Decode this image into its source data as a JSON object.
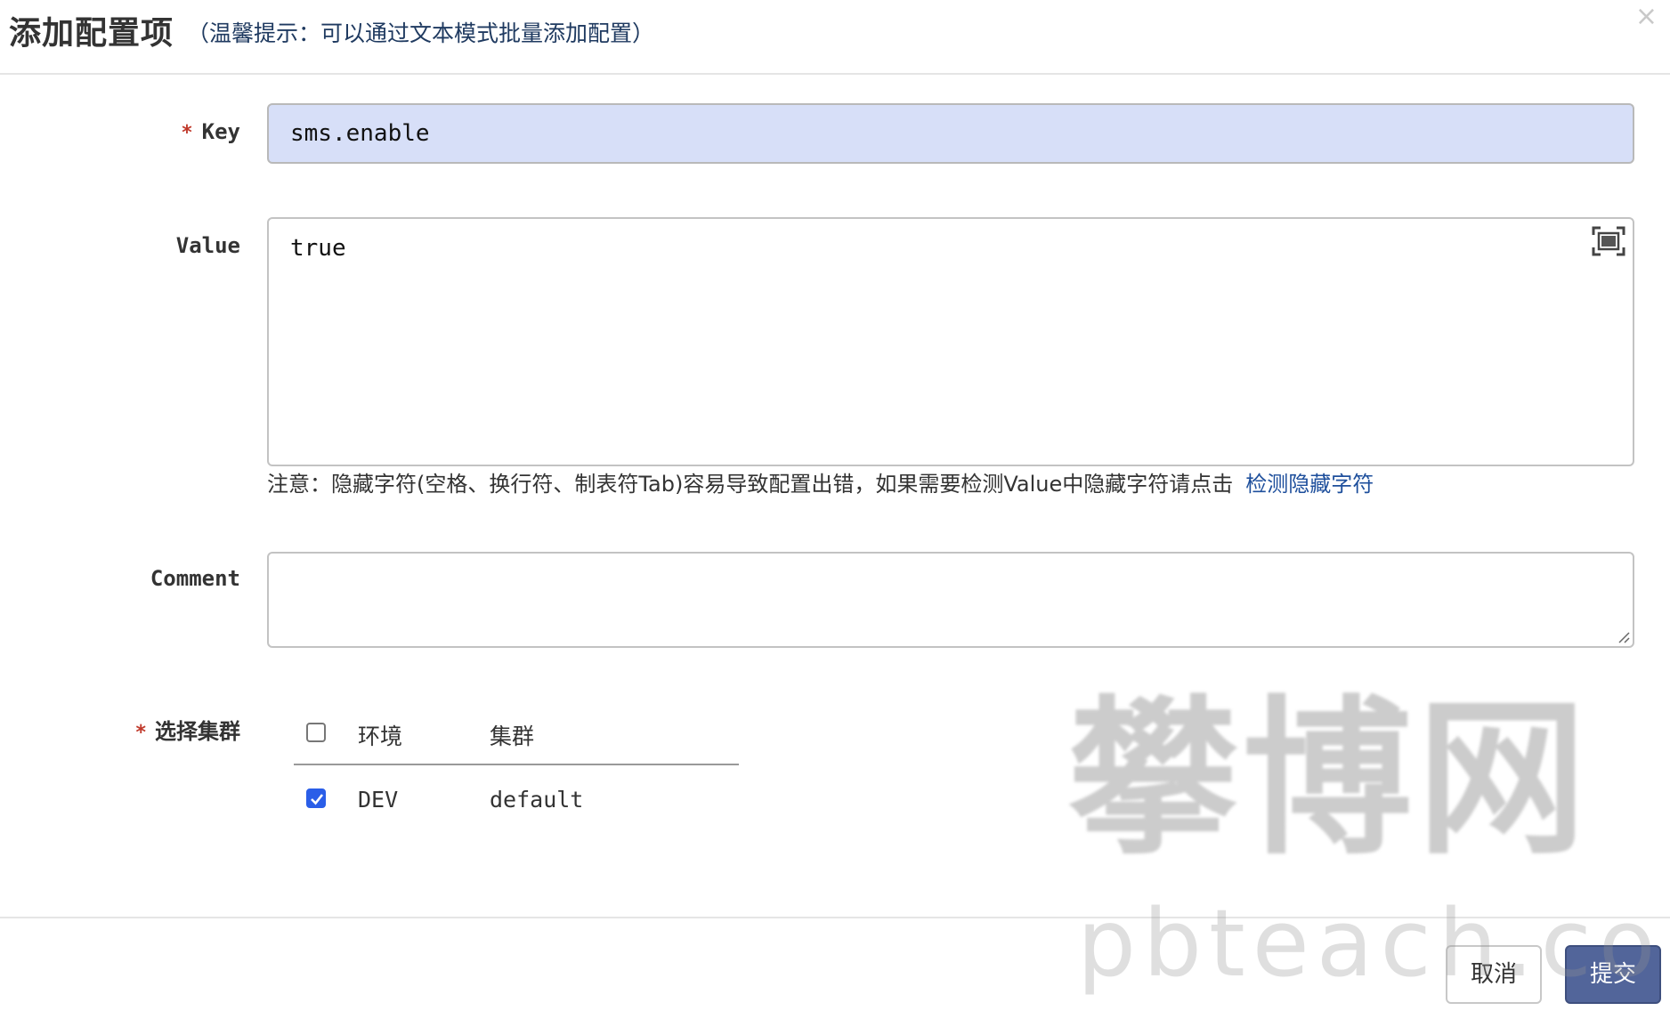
{
  "dialog": {
    "title": "添加配置项",
    "subtitle": "（温馨提示：可以通过文本模式批量添加配置）",
    "close_glyph": "×"
  },
  "form": {
    "key": {
      "required_mark": "*",
      "label": "Key",
      "value": "sms.enable"
    },
    "value": {
      "label": "Value",
      "text": "true",
      "fullscreen_icon": "fullscreen-icon",
      "note": "注意：隐藏字符(空格、换行符、制表符Tab)容易导致配置出错，如果需要检测Value中隐藏字符请点击",
      "note_link": "检测隐藏字符"
    },
    "comment": {
      "label": "Comment",
      "value": ""
    },
    "cluster": {
      "required_mark": "*",
      "label": "选择集群",
      "header_env": "环境",
      "header_cluster": "集群",
      "rows": [
        {
          "env": "DEV",
          "cluster": "default",
          "checked": true
        }
      ]
    }
  },
  "footer": {
    "cancel_label": "取消",
    "submit_label": "提交"
  },
  "watermark": {
    "cn": "攀博网",
    "en": "pbteach.com"
  },
  "colors": {
    "accent": "#52659a",
    "key_input_bg": "#d7dff8",
    "link": "#1e4f9c",
    "required": "#c0392b",
    "checkbox_checked": "#2a5ee8"
  }
}
